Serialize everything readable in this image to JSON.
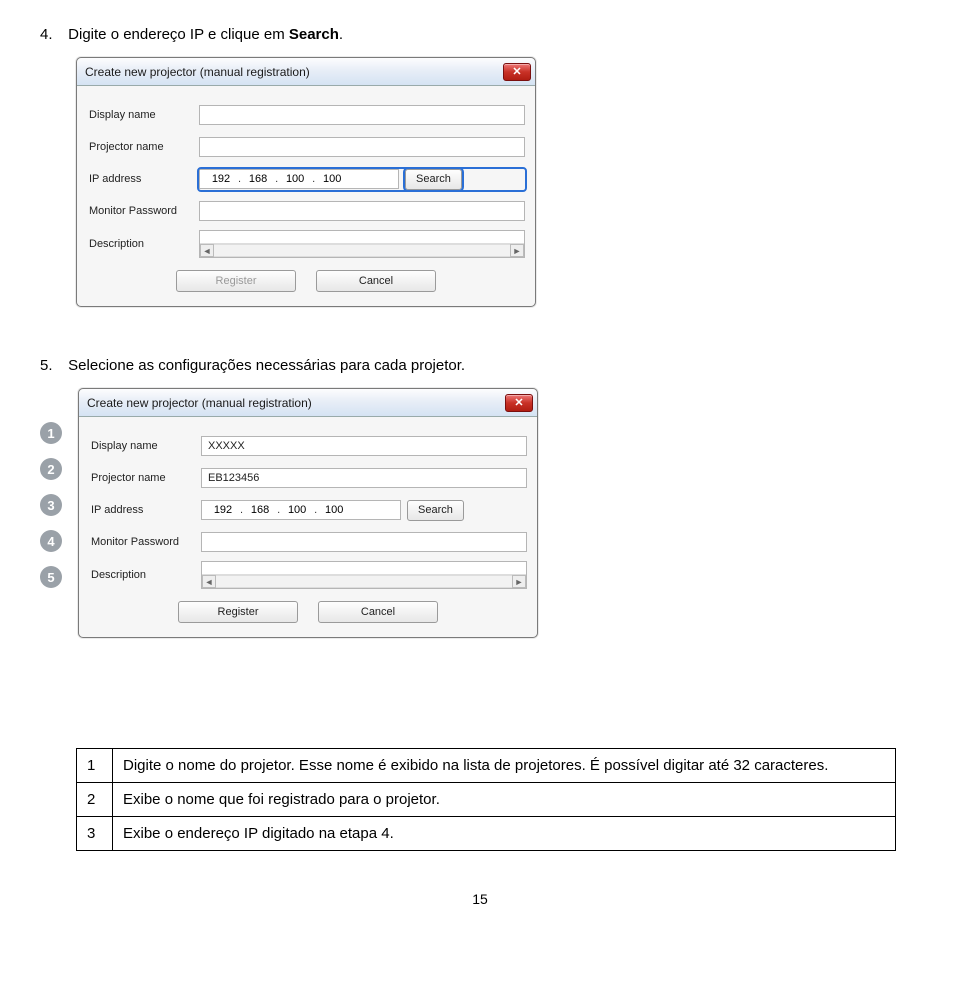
{
  "step4": {
    "num": "4.",
    "prefix": "Digite o endereço IP e clique em ",
    "bold": "Search",
    "suffix": "."
  },
  "step5": {
    "num": "5.",
    "text": "Selecione as configurações necessárias para cada projetor."
  },
  "dialog1": {
    "title": "Create new projector (manual registration)",
    "close_glyph": "✕",
    "labels": {
      "display_name": "Display name",
      "projector_name": "Projector name",
      "ip_address": "IP address",
      "monitor_password": "Monitor Password",
      "description": "Description"
    },
    "ip": {
      "o1": "192",
      "o2": "168",
      "o3": "100",
      "o4": "100"
    },
    "buttons": {
      "search": "Search",
      "register": "Register",
      "cancel": "Cancel"
    },
    "desc_scroll": {
      "left": "◄",
      "right": "►"
    },
    "values": {
      "display_name": "",
      "projector_name": "",
      "monitor_password": "",
      "description": ""
    }
  },
  "callouts": {
    "c1": "1",
    "c2": "2",
    "c3": "3",
    "c4": "4",
    "c5": "5"
  },
  "dialog2": {
    "title": "Create new projector (manual registration)",
    "close_glyph": "✕",
    "labels": {
      "display_name": "Display name",
      "projector_name": "Projector name",
      "ip_address": "IP address",
      "monitor_password": "Monitor Password",
      "description": "Description"
    },
    "values": {
      "display_name": "XXXXX",
      "projector_name": "EB123456",
      "monitor_password": "",
      "description": ""
    },
    "ip": {
      "o1": "192",
      "o2": "168",
      "o3": "100",
      "o4": "100"
    },
    "buttons": {
      "search": "Search",
      "register": "Register",
      "cancel": "Cancel"
    },
    "desc_scroll": {
      "left": "◄",
      "right": "►"
    }
  },
  "table": {
    "rows": [
      {
        "num": "1",
        "text": "Digite o nome do projetor. Esse nome é exibido na lista de projetores. É possível digitar até 32 caracteres."
      },
      {
        "num": "2",
        "text": "Exibe o nome que foi registrado para o projetor."
      },
      {
        "num": "3",
        "text": "Exibe o endereço IP digitado na etapa 4."
      }
    ]
  },
  "page_number": "15"
}
